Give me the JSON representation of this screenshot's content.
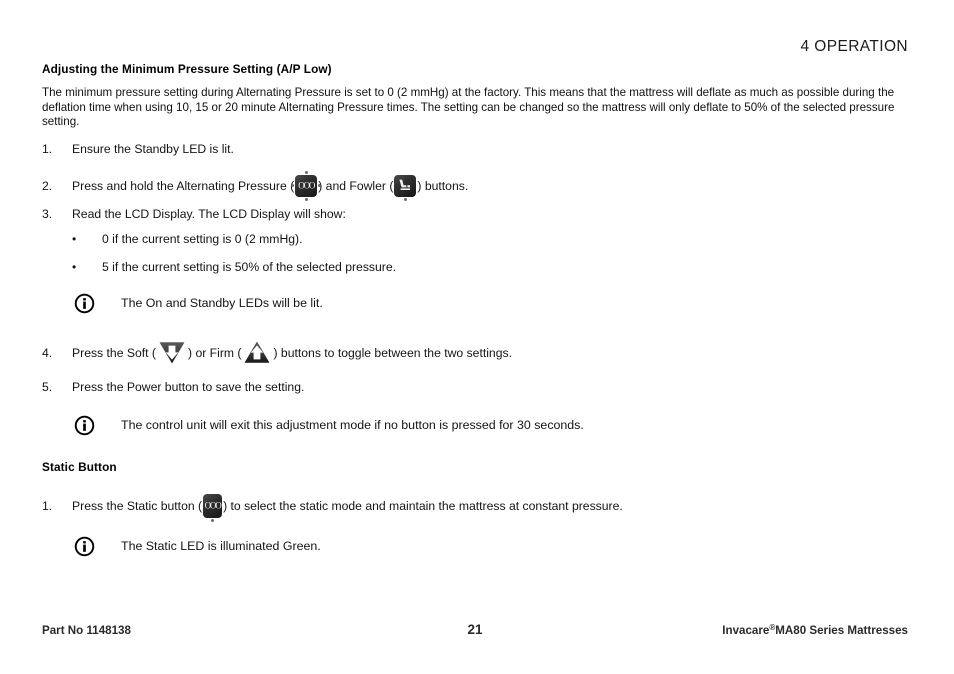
{
  "header": {
    "chapter": "4 OPERATION"
  },
  "sections": [
    {
      "title": "Adjusting the Minimum Pressure Setting (A/P Low)",
      "paragraph": "The minimum pressure setting during Alternating Pressure is set to 0 (2 mmHg) at the factory. This means that the mattress will deflate as much as possible during the deflation time when using 10, 15 or 20 minute Alternating Pressure times. The setting can be changed so the mattress will only deflate to 50% of the selected pressure setting."
    },
    {
      "title": "Static Button"
    }
  ],
  "steps": {
    "s1_num": "1.",
    "s1_text": "Ensure the Standby LED is lit.",
    "s2_num": "2.",
    "s2_a": "Press and hold the Alternating Pressure (",
    "s2_b": ") and Fowler (",
    "s2_c": ") buttons.",
    "s3_num": "3.",
    "s3_text": "Read the LCD Display. The LCD Display will show:",
    "s4_num": "4.",
    "s4_a": "Press the Soft (",
    "s4_b": ") or Firm (",
    "s4_c": ") buttons to toggle between the two settings.",
    "s5_num": "5.",
    "s5_text": "Press the Power button to save the setting.",
    "static_num": "1.",
    "static_a": "Press the Static button (",
    "static_b": ") to select the static mode and maintain the mattress at constant pressure."
  },
  "bullets": {
    "marker": "•",
    "b1": "0 if the current setting is 0 (2 mmHg).",
    "b2": "5 if the current setting is 50% of the selected pressure."
  },
  "notes": {
    "n1": "The On and Standby LEDs will be lit.",
    "n2": "The control unit will exit this adjustment mode if no button is pressed for 30 seconds.",
    "n3": "The Static LED is illuminated Green."
  },
  "icons": {
    "alternating_pressure": "alternating-pressure-button-icon",
    "fowler": "fowler-button-icon",
    "soft": "soft-button-icon",
    "firm": "firm-button-icon",
    "static": "static-button-icon",
    "note": "info-icon",
    "ap_glyph": "OOO",
    "static_glyph": "OOO"
  },
  "footer": {
    "part_label": "Part No 1148138",
    "page_number": "21",
    "brand": "Invacare",
    "reg": "®",
    "product": "MA80 Series Mattresses"
  },
  "colors": {
    "text": "#000000",
    "icon_dark": "#2c2c2c",
    "page_bg": "#ffffff"
  }
}
